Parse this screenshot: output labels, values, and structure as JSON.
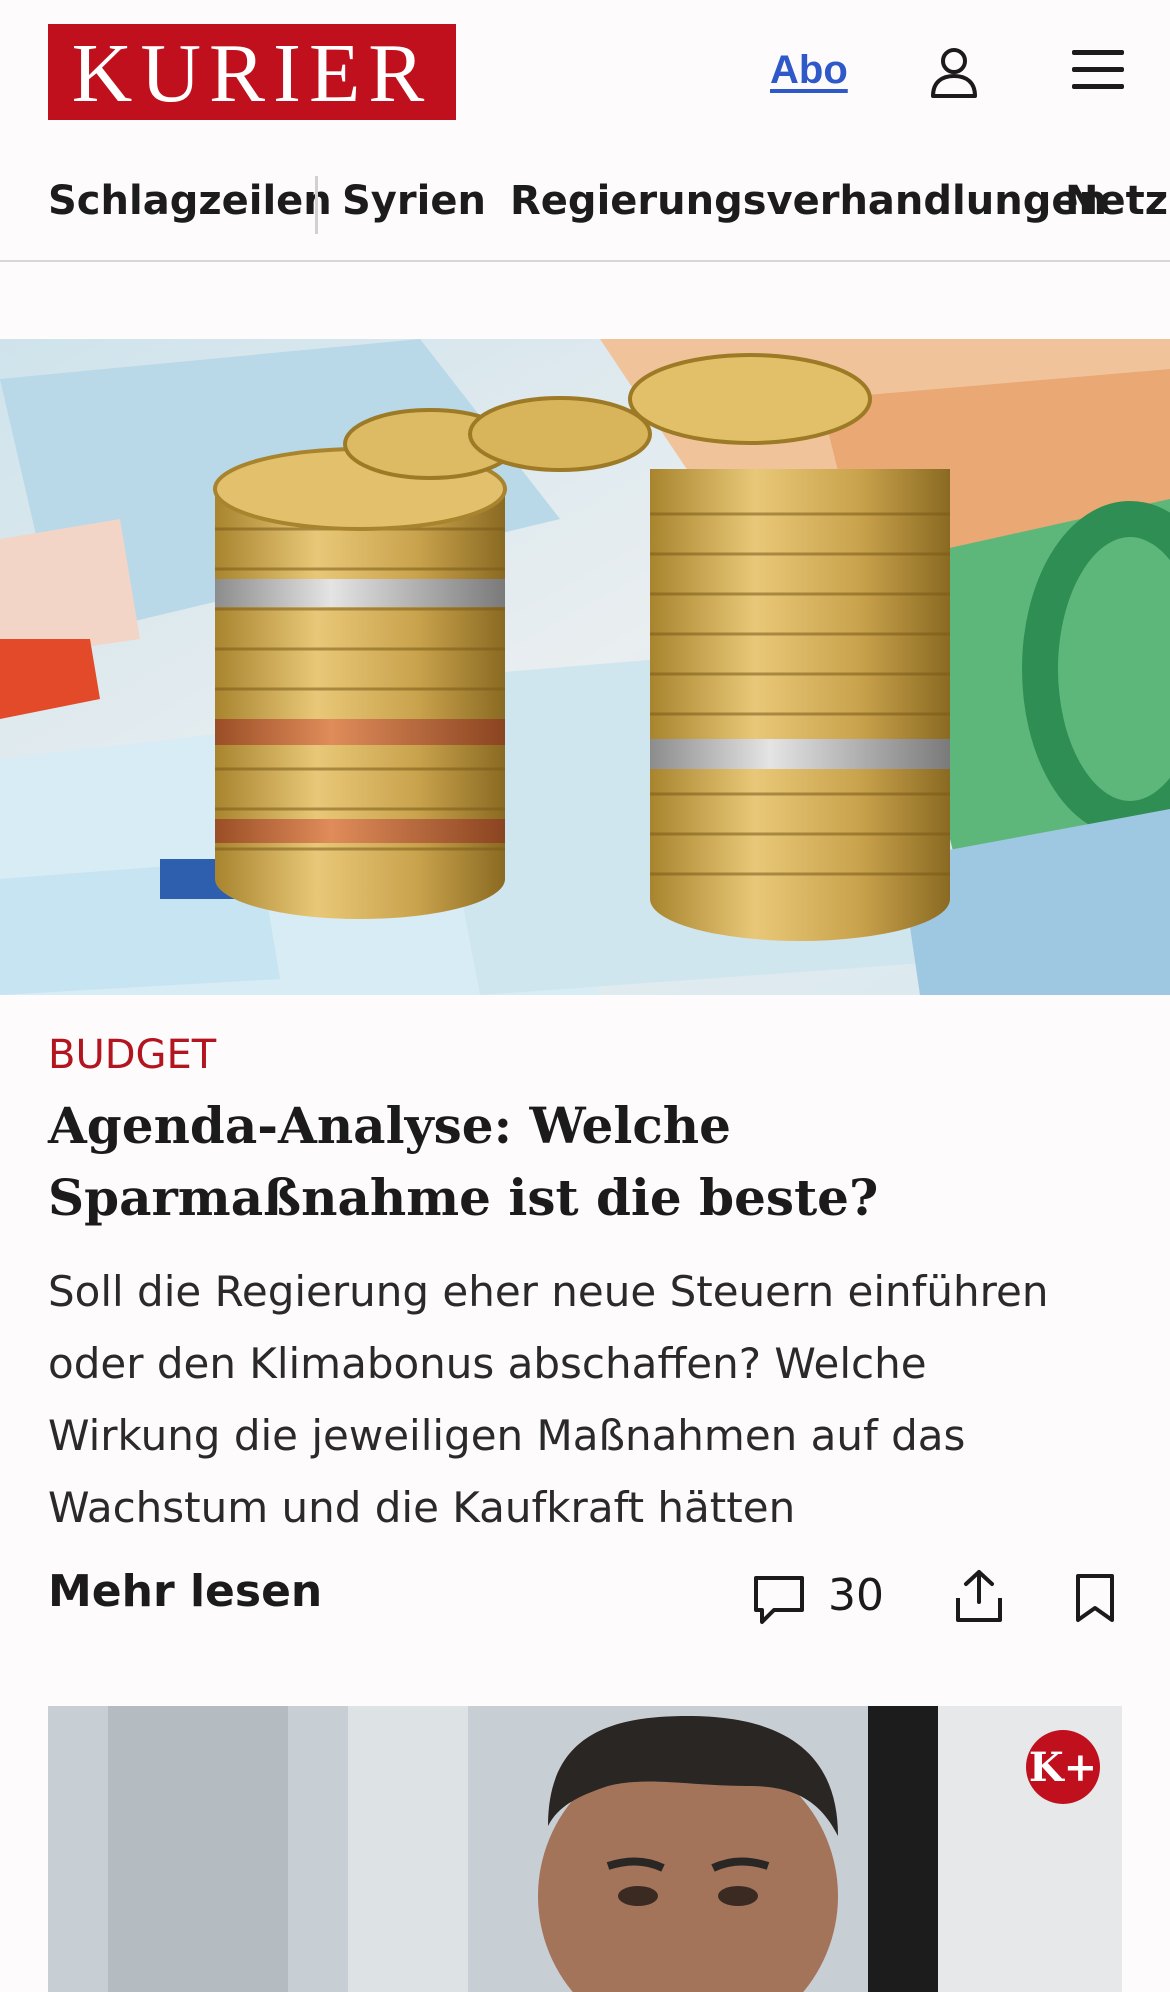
{
  "header": {
    "logo_text": "KURIER",
    "abo_label": "Abo",
    "user_icon": "user-icon",
    "menu_icon": "hamburger-menu-icon",
    "brand_color": "#c0101e",
    "link_color": "#2f59c8"
  },
  "nav": {
    "items": [
      {
        "label": "Schlagzeilen"
      },
      {
        "label": "Syrien"
      },
      {
        "label": "Regierungsverhandlungen"
      },
      {
        "label": "Netz-"
      }
    ]
  },
  "article": {
    "image_alt": "Euro coins stacked on euro banknotes",
    "category": "BUDGET",
    "category_color": "#b2151f",
    "headline": "Agenda-Analyse: Welche Sparmaßnahme ist die beste?",
    "teaser": "Soll die Regierung eher neue Steuern einführen oder den Klimabonus abschaffen? Welche Wirkung die jeweiligen Maßnahmen auf das Wachstum und die Kaufkraft hätten",
    "more_label": "Mehr lesen",
    "comment_count": "30",
    "comment_icon": "comment-icon",
    "share_icon": "share-icon",
    "bookmark_icon": "bookmark-icon"
  },
  "next_card": {
    "badge": "K+",
    "image_alt": "Portrait of a man"
  }
}
